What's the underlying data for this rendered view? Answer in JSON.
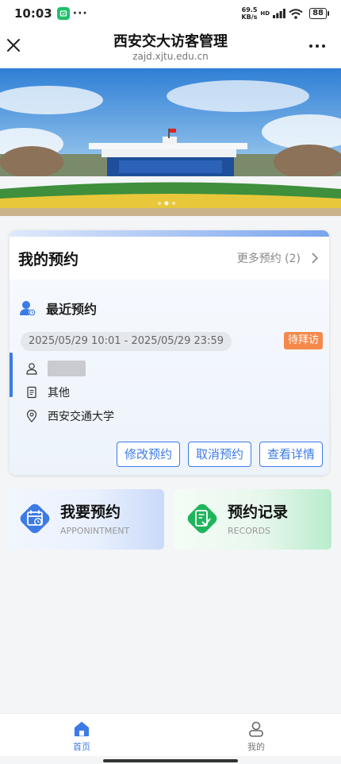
{
  "status_bar": {
    "time": "10:03",
    "dots": "···",
    "net_speed_value": "69.5",
    "net_speed_unit": "KB/s",
    "hd": "HD",
    "battery": "88"
  },
  "header": {
    "title": "西安交大访客管理",
    "subtitle": "zajd.xjtu.edu.cn"
  },
  "banner": {
    "slide_count": 3,
    "active_slide": 1
  },
  "my_appointments": {
    "title": "我的预约",
    "more_link": "更多预约 (2)",
    "recent": {
      "heading": "最近预约",
      "time_range": "2025/05/29 10:01 - 2025/05/29 23:59",
      "status": "待拜访",
      "purpose": "其他",
      "location": "西安交通大学"
    },
    "actions": {
      "modify": "修改预约",
      "cancel": "取消预约",
      "details": "查看详情"
    }
  },
  "features": {
    "book": {
      "title": "我要预约",
      "subtitle": "APPONINTMENT"
    },
    "records": {
      "title": "预约记录",
      "subtitle": "RECORDS"
    }
  },
  "tabbar": {
    "home": "首页",
    "mine": "我的"
  },
  "colors": {
    "accent": "#3c7be6",
    "status_orange": "#f5894b",
    "record_green": "#1fb55c"
  },
  "icons": {
    "close": "close-icon",
    "more": "more-icon",
    "user": "user-icon",
    "document": "document-icon",
    "location": "location-pin-icon",
    "calendar": "calendar-icon",
    "records": "records-icon",
    "home": "home-icon",
    "profile": "profile-icon"
  }
}
